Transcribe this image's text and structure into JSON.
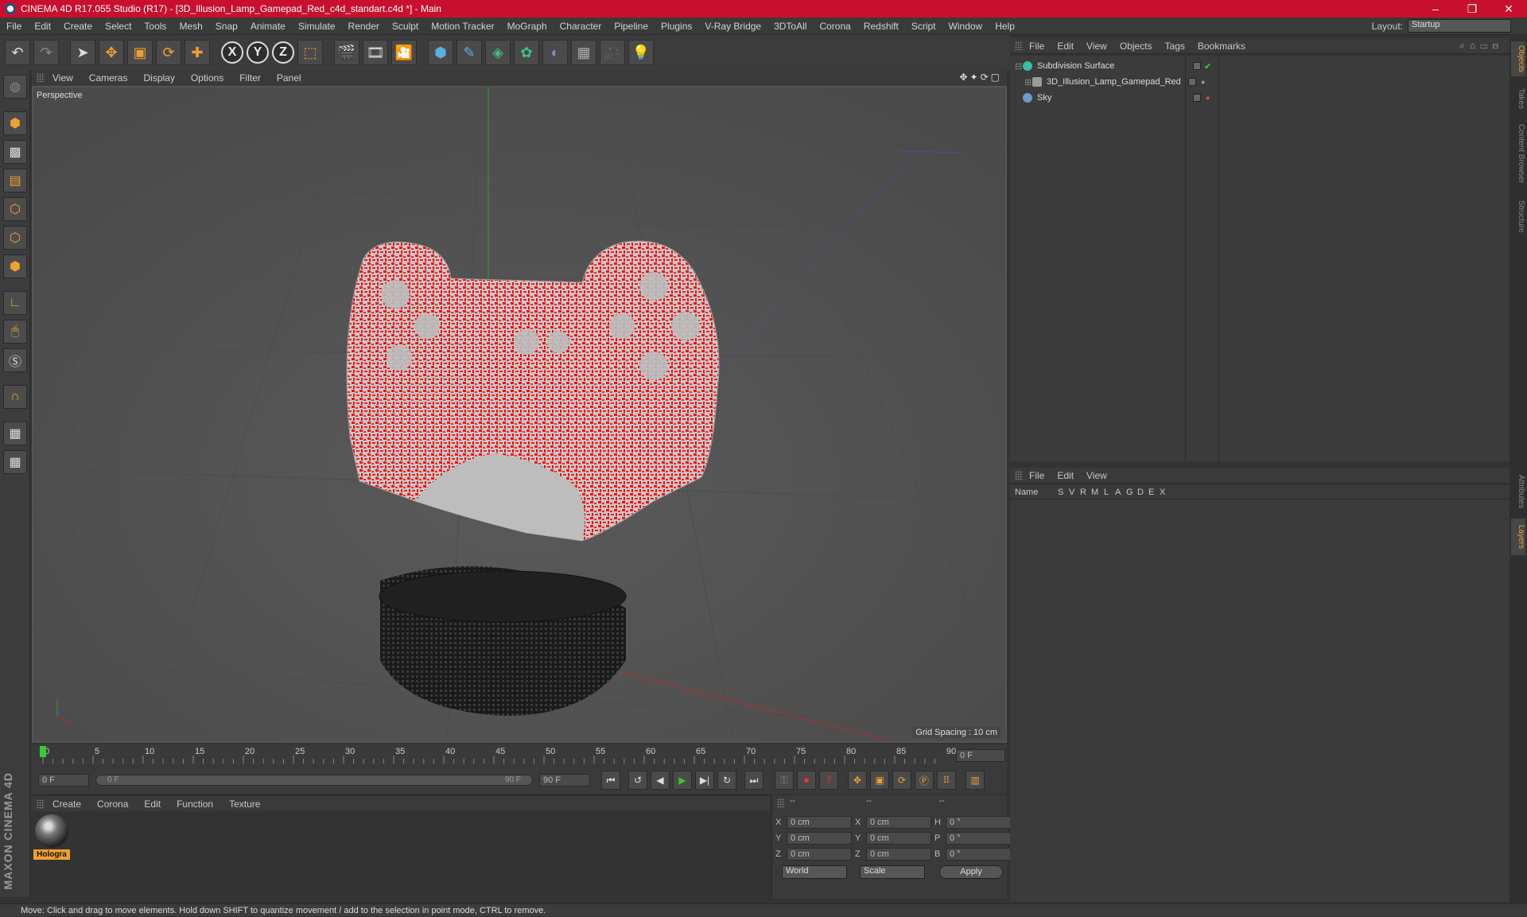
{
  "window": {
    "title": "CINEMA 4D R17.055 Studio (R17) - [3D_Illusion_Lamp_Gamepad_Red_c4d_standart.c4d *] - Main",
    "controls": [
      "–",
      "❐",
      "✕"
    ]
  },
  "menubar": {
    "items": [
      "File",
      "Edit",
      "Create",
      "Select",
      "Tools",
      "Mesh",
      "Snap",
      "Animate",
      "Simulate",
      "Render",
      "Sculpt",
      "Motion Tracker",
      "MoGraph",
      "Character",
      "Pipeline",
      "Plugins",
      "V-Ray Bridge",
      "3DToAll",
      "Corona",
      "Redshift",
      "Script",
      "Window",
      "Help"
    ],
    "layout_label": "Layout:",
    "layout_value": "Startup"
  },
  "viewport": {
    "menu": [
      "View",
      "Cameras",
      "Display",
      "Options",
      "Filter",
      "Panel"
    ],
    "label": "Perspective",
    "grid_spacing": "Grid Spacing : 10 cm",
    "nav_icons": "✥✦⟳▢"
  },
  "timeline": {
    "ticks": [
      "0",
      "5",
      "10",
      "15",
      "20",
      "25",
      "30",
      "35",
      "40",
      "45",
      "50",
      "55",
      "60",
      "65",
      "70",
      "75",
      "80",
      "85",
      "90"
    ],
    "current_frame": "0 F"
  },
  "transport": {
    "start": "0 F",
    "range_start": "0 F",
    "range_end": "90 F",
    "end": "90 F"
  },
  "materials": {
    "menu": [
      "Create",
      "Corona",
      "Edit",
      "Function",
      "Texture"
    ],
    "items": [
      {
        "name": "Hologra"
      }
    ]
  },
  "coords": {
    "headers": [
      "--",
      "--",
      "--"
    ],
    "rows": [
      {
        "a": "X",
        "av": "0 cm",
        "b": "X",
        "bv": "0 cm",
        "c": "H",
        "cv": "0 °"
      },
      {
        "a": "Y",
        "av": "0 cm",
        "b": "Y",
        "bv": "0 cm",
        "c": "P",
        "cv": "0 °"
      },
      {
        "a": "Z",
        "av": "0 cm",
        "b": "Z",
        "bv": "0 cm",
        "c": "B",
        "cv": "0 °"
      }
    ],
    "mode1": "World",
    "mode2": "Scale",
    "apply": "Apply"
  },
  "object_manager": {
    "menu": [
      "File",
      "Edit",
      "View",
      "Objects",
      "Tags",
      "Bookmarks"
    ],
    "objects": [
      {
        "name": "Subdivision Surface",
        "icon_color": "#38c0a0"
      },
      {
        "name": "3D_Illusion_Lamp_Gamepad_Red",
        "icon_color": "#9a9a9a"
      },
      {
        "name": "Sky",
        "icon_color": "#6a9ad0"
      }
    ]
  },
  "layer_manager": {
    "menu": [
      "File",
      "Edit",
      "View"
    ],
    "columns": [
      "Name",
      "S",
      "V",
      "R",
      "M",
      "L",
      "A",
      "G",
      "D",
      "E",
      "X"
    ]
  },
  "right_tabs": [
    "Objects",
    "Takes",
    "Content Browser",
    "Structure",
    "Attributes",
    "Layers"
  ],
  "branding": "MAXON CINEMA 4D",
  "status": "Move: Click and drag to move elements. Hold down SHIFT to quantize movement / add to the selection in point mode, CTRL to remove."
}
